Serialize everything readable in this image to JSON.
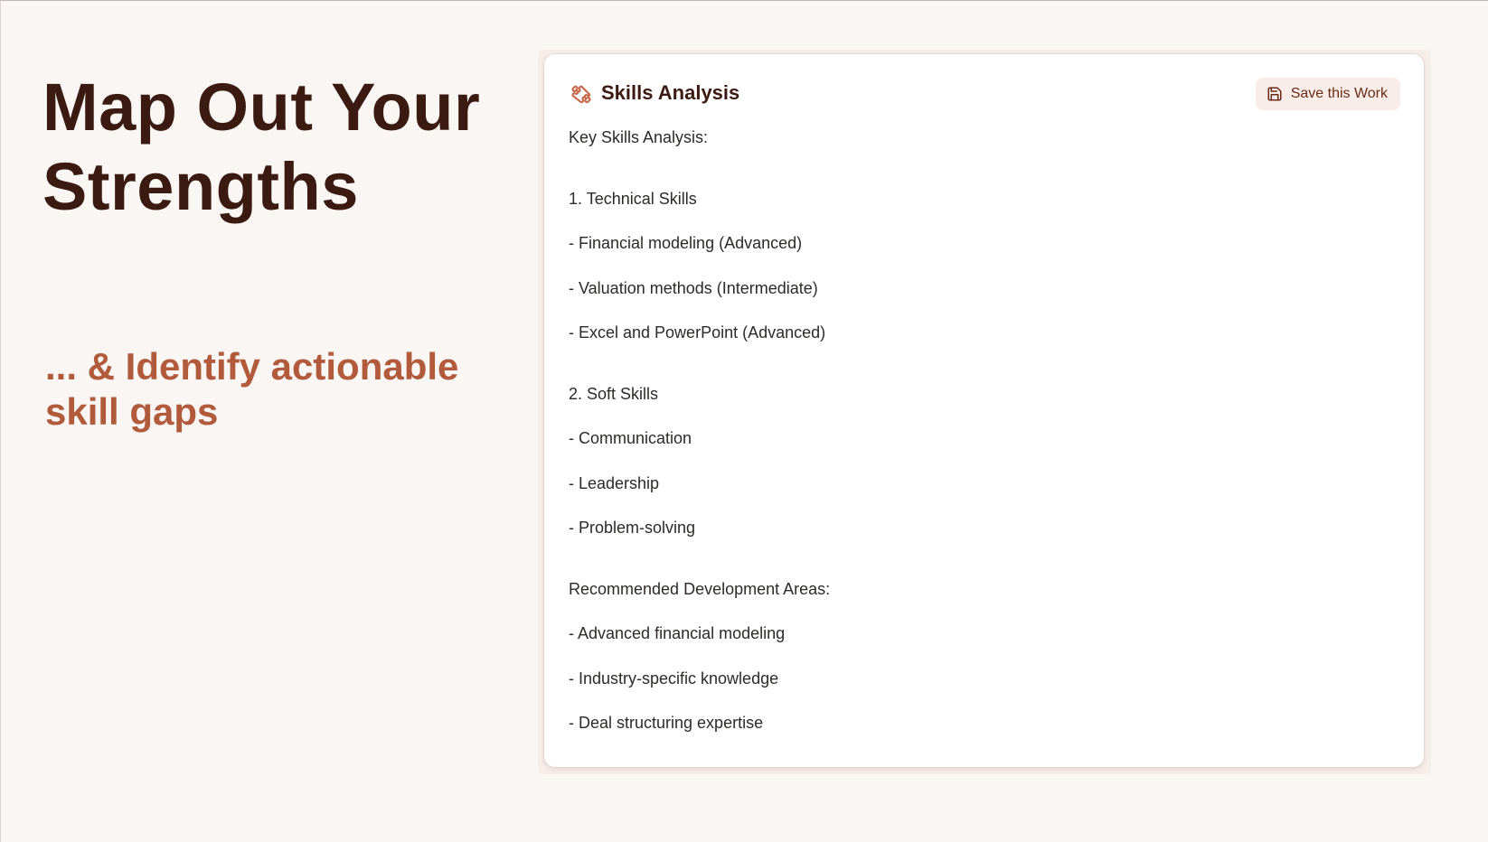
{
  "hero": {
    "title": "Map Out Your Strengths",
    "subtitle": "... & Identify actionable skill gaps"
  },
  "card": {
    "title": "Skills Analysis",
    "title_icon": "puzzle-icon",
    "save_label": "Save this Work",
    "save_icon": "save-icon",
    "intro": "Key Skills Analysis:",
    "technical_heading": "1. Technical Skills",
    "technical_items": [
      "- Financial modeling (Advanced)",
      "- Valuation methods (Intermediate)",
      "- Excel and PowerPoint (Advanced)"
    ],
    "soft_heading": "2. Soft Skills",
    "soft_items": [
      "- Communication",
      "- Leadership",
      "- Problem-solving"
    ],
    "development_heading": "Recommended Development Areas:",
    "development_items": [
      "- Advanced financial modeling",
      "- Industry-specific knowledge",
      "- Deal structuring expertise"
    ]
  },
  "colors": {
    "background": "#faf6f4",
    "title": "#3b1a12",
    "accent": "#b15a3c",
    "button_bg": "#f8ede8"
  }
}
